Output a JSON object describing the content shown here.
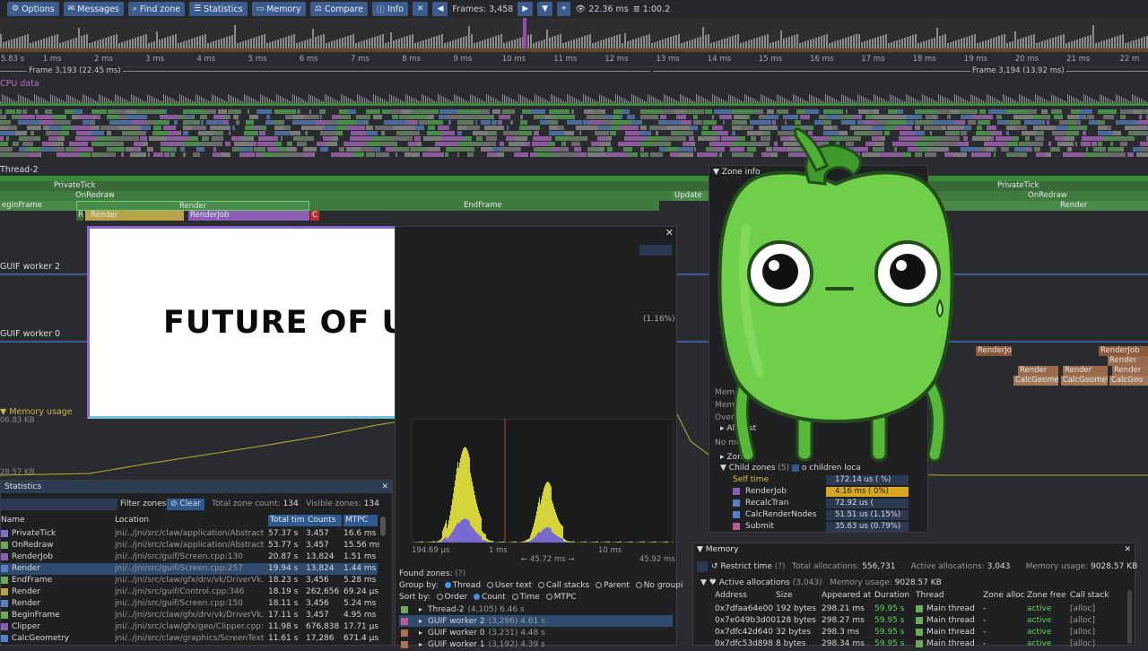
{
  "toolbar": {
    "options": "Options",
    "messages": "Messages",
    "find_zone": "Find zone",
    "statistics": "Statistics",
    "memory": "Memory",
    "compare": "Compare",
    "info": "Info",
    "frames_label": "Frames: 3,458",
    "frame_time": "22.36 ms",
    "total_time": "1:00.2"
  },
  "ruler": {
    "ticks": [
      "5.83 s",
      "1 ms",
      "2 ms",
      "3 ms",
      "4 ms",
      "5 ms",
      "6 ms",
      "7 ms",
      "8 ms",
      "9 ms",
      "10 ms",
      "11 ms",
      "12 ms",
      "13 ms",
      "14 ms",
      "15 ms",
      "16 ms",
      "17 ms",
      "18 ms",
      "19 ms",
      "20 ms",
      "21 ms",
      "22 m"
    ]
  },
  "frames_row": {
    "frame_a": "Frame 3,193 (22.45 ms)",
    "frame_b": "Frame 3,194 (13.92 ms)"
  },
  "timeline": {
    "cpu_data": "CPU data",
    "thread2": "Thread-2",
    "worker2": "GUIF worker 2",
    "worker0": "GUIF worker 0",
    "memory_usage": "Memory usage",
    "mem_top": "06.83 KB",
    "mem_bottom": "28.57 KB",
    "zones": {
      "private_tick": "PrivateTick",
      "on_redraw": "OnRedraw",
      "begin_frame": "eginFrame",
      "render": "Render",
      "end_frame": "EndFrame",
      "render_job": "RenderJob",
      "update": "Update",
      "c": "C",
      "r": "R"
    },
    "right_zones": [
      "PrivateTick",
      "OnRedraw",
      "Render",
      "RenderJob",
      "Render",
      "Render",
      "Render",
      "Render",
      "CalcGeome",
      "CalcGeomet",
      "CalcGeo"
    ]
  },
  "title_card": {
    "text": "FUTURE OF UI IN C++"
  },
  "statistics": {
    "title": "Statistics",
    "filter_label": "Filter zones",
    "clear": "Clear",
    "total_zone_count_label": "Total zone count:",
    "total_zone_count": "134",
    "visible_zones_label": "Visible zones:",
    "visible_zones": "134",
    "columns": [
      "Name",
      "Location",
      "Total tim",
      "Counts",
      "MTPC"
    ],
    "rows": [
      {
        "name": "PrivateTick",
        "loc": "jni/../jni/src/claw/application/AbstractApp",
        "total": "57.37 s",
        "count": "3,457",
        "mtpc": "16.6 ms",
        "color": "#7b6fc7"
      },
      {
        "name": "OnRedraw",
        "loc": "jni/../jni/src/claw/application/AbstractApp",
        "total": "53.77 s",
        "count": "3,457",
        "mtpc": "15.56 ms",
        "color": "#6fa85c"
      },
      {
        "name": "RenderJob",
        "loc": "jni/../jni/src/guif/Screen.cpp:130",
        "total": "20.87 s",
        "count": "13,824",
        "mtpc": "1.51 ms",
        "color": "#8a5fb5"
      },
      {
        "name": "Render",
        "loc": "jni/../jni/src/guif/Screen.cpp:257",
        "total": "19.94 s",
        "count": "13,824",
        "mtpc": "1.44 ms",
        "color": "#5b7fc4"
      },
      {
        "name": "EndFrame",
        "loc": "jni/../jni/src/claw/gfx/drv/vk/DriverVk.cpp",
        "total": "18.23 s",
        "count": "3,456",
        "mtpc": "5.28 ms",
        "color": "#6fa85c"
      },
      {
        "name": "Render",
        "loc": "jni/../jni/src/guif/Control.cpp:346",
        "total": "18.19 s",
        "count": "262,656",
        "mtpc": "69.24 µs",
        "color": "#b8a24a"
      },
      {
        "name": "Render",
        "loc": "jni/../jni/src/guif/Screen.cpp:150",
        "total": "18.11 s",
        "count": "3,456",
        "mtpc": "5.24 ms",
        "color": "#5b7fc4"
      },
      {
        "name": "BeginFrame",
        "loc": "jni/../jni/src/claw/gfx/drv/vk/DriverVk.cpp",
        "total": "17.11 s",
        "count": "3,457",
        "mtpc": "4.95 ms",
        "color": "#6fa85c"
      },
      {
        "name": "Clipper",
        "loc": "jni/../jni/src/claw/gfx/geo/Clipper.cpp:175",
        "total": "11.98 s",
        "count": "676,838",
        "mtpc": "17.71 µs",
        "color": "#8a5fb5"
      },
      {
        "name": "CalcGeometry",
        "loc": "jni/../jni/src/claw/graphics/ScreenText.cpp",
        "total": "11.61 s",
        "count": "17,286",
        "mtpc": "671.4 µs",
        "color": "#5b7fc4"
      }
    ]
  },
  "find_zone": {
    "pct": "(1.16%)",
    "axis_min": "194.69 µs",
    "axis_1ms": "1 ms",
    "axis_mid": "← 45.72 ms →",
    "axis_10ms": "10 ms",
    "axis_max": "45.92 ms",
    "found_zones": "Found zones:",
    "help": "(?)",
    "group_by": "Group by:",
    "group_options": [
      "Thread",
      "User text",
      "Call stacks",
      "Parent",
      "No groupi"
    ],
    "sort_by": "Sort by:",
    "sort_options": [
      "Order",
      "Count",
      "Time",
      "MTPC"
    ],
    "groups": [
      {
        "name": "Thread-2",
        "detail": "(4,105) 6.46 s",
        "color": "#6fa85c"
      },
      {
        "name": "GUIF worker 2",
        "detail": "(3,296) 4.61 s",
        "color": "#c05a9c"
      },
      {
        "name": "GUIF worker 0",
        "detail": "(3,231) 4.48 s",
        "color": "#b07050"
      },
      {
        "name": "GUIF worker 1",
        "detail": "(3,192) 4.39 s",
        "color": "#b07050"
      }
    ]
  },
  "zone_info": {
    "title": "Zone info",
    "alloc_list": "Allo            list",
    "no_mes": "No mes",
    "zone": "Zon",
    "child_zones": "Child zones",
    "child_count": "(5)",
    "children_loc": "o children loca",
    "self_time": "Self time",
    "items": [
      {
        "name": "RenderJob",
        "value": "4.16 ms (   0%)",
        "color": "#8a5fb5"
      },
      {
        "name": "RecalcTran",
        "value": "72.92 us (",
        "color": "#5b7fc4"
      },
      {
        "name": "CalcRenderNodes",
        "value": "51.51 us (1.15%)",
        "color": "#5b7fc4"
      },
      {
        "name": "Submit",
        "value": "35.63 us (0.79%)",
        "color": "#c05a9c"
      }
    ],
    "self_value": "172.14 us (    %)",
    "overall": "Overal",
    "mem": "Mem",
    "mem2": "Memo"
  },
  "memory": {
    "title": "Memory",
    "restrict_time": "Restrict time",
    "help": "(?)",
    "total_alloc_label": "Total allocations:",
    "total_alloc": "556,731",
    "active_alloc_label": "Active allocations:",
    "active_alloc": "3,043",
    "mem_usage_label": "Memory usage:",
    "mem_usage": "9028.57 KB",
    "active_title": "Active allocations",
    "active_count": "(3,043)",
    "mem_usage2_label": "Memory usage:",
    "mem_usage2": "9028.57 KB",
    "columns": [
      "Address",
      "Size",
      "Appeared at",
      "Duration",
      "Thread",
      "Zone alloc",
      "Zone free",
      "Call stack"
    ],
    "rows": [
      {
        "addr": "0x7dfaa64e00",
        "size": "192 bytes",
        "appeared": "298.21 ms",
        "duration": "59.95 s",
        "thread": "Main thread",
        "zalloc": "-",
        "zfree": "active",
        "stack": "[alloc]"
      },
      {
        "addr": "0x7e049b3d00",
        "size": "128 bytes",
        "appeared": "298.27 ms",
        "duration": "59.95 s",
        "thread": "Main thread",
        "zalloc": "-",
        "zfree": "active",
        "stack": "[alloc]"
      },
      {
        "addr": "0x7dfc42d640",
        "size": "32 bytes",
        "appeared": "298.3 ms",
        "duration": "59.95 s",
        "thread": "Main thread",
        "zalloc": "-",
        "zfree": "active",
        "stack": "[alloc]"
      },
      {
        "addr": "0x7dfc53d898",
        "size": "8 bytes",
        "appeared": "298.34 ms",
        "duration": "59.95 s",
        "thread": "Main thread",
        "zalloc": "-",
        "zfree": "active",
        "stack": "[alloc]"
      }
    ]
  },
  "mascot": {
    "name": "green-pepper-mascot"
  }
}
